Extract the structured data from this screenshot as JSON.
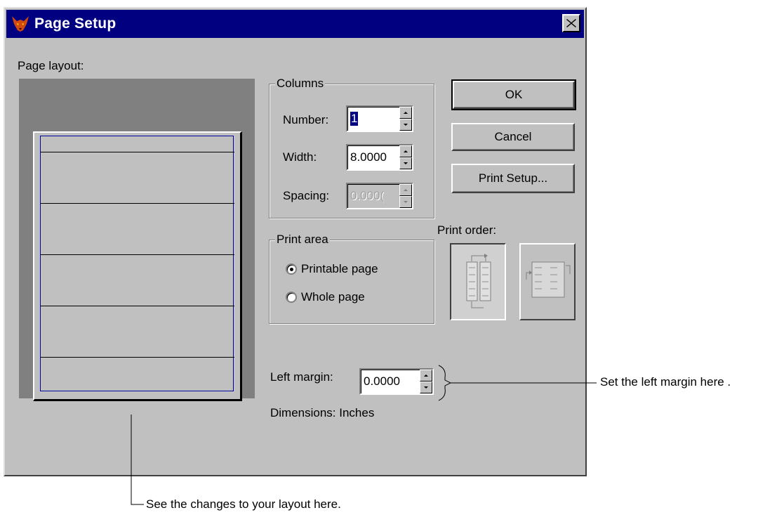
{
  "window": {
    "title": "Page Setup",
    "close_label": "×"
  },
  "preview": {
    "label": "Page layout:"
  },
  "columns": {
    "title": "Columns",
    "number_label": "Number:",
    "number_value": "1",
    "width_label": "Width:",
    "width_value": "8.0000",
    "spacing_label": "Spacing:",
    "spacing_value": "0.000(",
    "spacing_disabled": true
  },
  "print_area": {
    "title": "Print area",
    "options": [
      {
        "label": "Printable page",
        "selected": true
      },
      {
        "label": "Whole page",
        "selected": false
      }
    ]
  },
  "buttons": {
    "ok": "OK",
    "cancel": "Cancel",
    "print_setup": "Print Setup..."
  },
  "print_order": {
    "label": "Print order:",
    "options": [
      {
        "icon": "top-to-bottom-order-icon",
        "pressed": true
      },
      {
        "icon": "left-to-right-order-icon",
        "pressed": false
      }
    ]
  },
  "left_margin": {
    "label": "Left margin:",
    "value": "0.0000"
  },
  "dimensions": {
    "label": "Dimensions: Inches"
  },
  "callouts": {
    "left_margin_note": "Set the left margin here .",
    "layout_note": "See the changes to your layout here."
  }
}
